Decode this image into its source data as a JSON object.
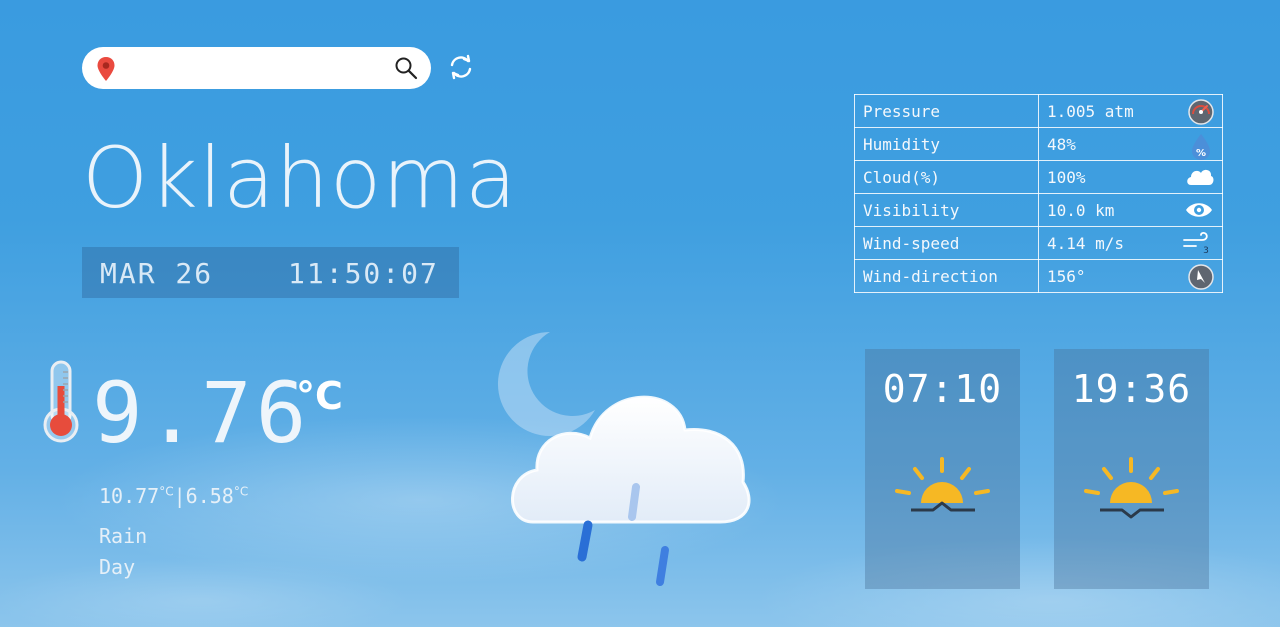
{
  "search": {
    "placeholder": "",
    "value": ""
  },
  "location": {
    "city": "Oklahoma",
    "date": "MAR 26",
    "time": "11:50:07"
  },
  "current": {
    "temperature": "9.76",
    "unit": "°C",
    "max": "10.77",
    "min": "6.58",
    "minmax_unit": "°C",
    "separator": "|",
    "condition": "Rain",
    "period": "Day"
  },
  "stats": [
    {
      "label": "Pressure",
      "value": "1.005 atm",
      "icon": "gauge-icon"
    },
    {
      "label": "Humidity",
      "value": "48%",
      "icon": "humidity-drop-icon"
    },
    {
      "label": "Cloud(%)",
      "value": "100%",
      "icon": "cloud-icon"
    },
    {
      "label": "Visibility",
      "value": "10.0 km",
      "icon": "eye-icon"
    },
    {
      "label": "Wind-speed",
      "value": "4.14 m/s",
      "icon": "wind-icon"
    },
    {
      "label": "Wind-direction",
      "value": "156°",
      "icon": "compass-icon"
    }
  ],
  "humidity_icon_text": "%",
  "wind_icon_text": "3",
  "sun": {
    "sunrise": "07:10",
    "sunset": "19:36"
  },
  "colors": {
    "sun": "#f6b824",
    "pin": "#ea4a3f",
    "thermometer": "#e74c3c"
  }
}
